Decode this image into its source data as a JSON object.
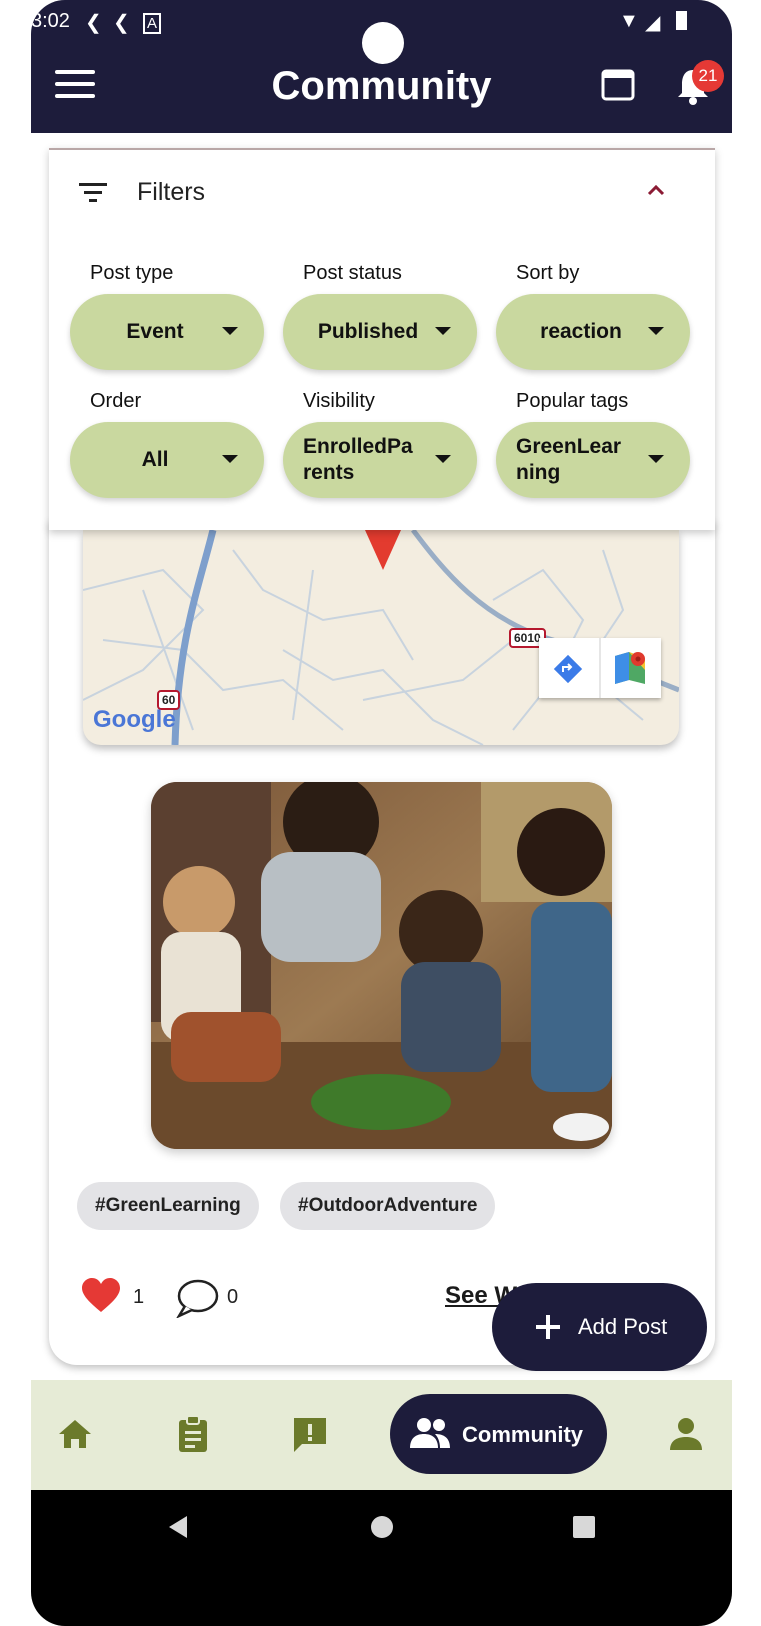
{
  "status_bar": {
    "time": "3:02"
  },
  "app_bar": {
    "title": "Community",
    "notification_count": "21"
  },
  "filters": {
    "title": "Filters",
    "items": [
      {
        "label": "Post type",
        "value": "Event"
      },
      {
        "label": "Post status",
        "value": "Published"
      },
      {
        "label": "Sort by",
        "value": "reaction"
      },
      {
        "label": "Order",
        "value": "All"
      },
      {
        "label": "Visibility",
        "value": "EnrolledPa\nrents"
      },
      {
        "label": "Popular tags",
        "value": "GreenLear\nning"
      }
    ]
  },
  "post": {
    "map": {
      "road_label_1": "6010",
      "road_label_2": "60",
      "map_provider": "Google"
    },
    "tags": [
      "#GreenLearning",
      "#OutdoorAdventure"
    ],
    "likes": "1",
    "comments": "0",
    "see_link": "See W"
  },
  "fab": {
    "label": "Add Post"
  },
  "bottom_nav": {
    "active_label": "Community"
  },
  "colors": {
    "primary_dark": "#1d1c3b",
    "chip_green": "#c9d89f",
    "nav_bg": "#e6ebd6",
    "nav_icon": "#6b7a2b",
    "badge_red": "#e53935",
    "heart_red": "#e53935"
  }
}
